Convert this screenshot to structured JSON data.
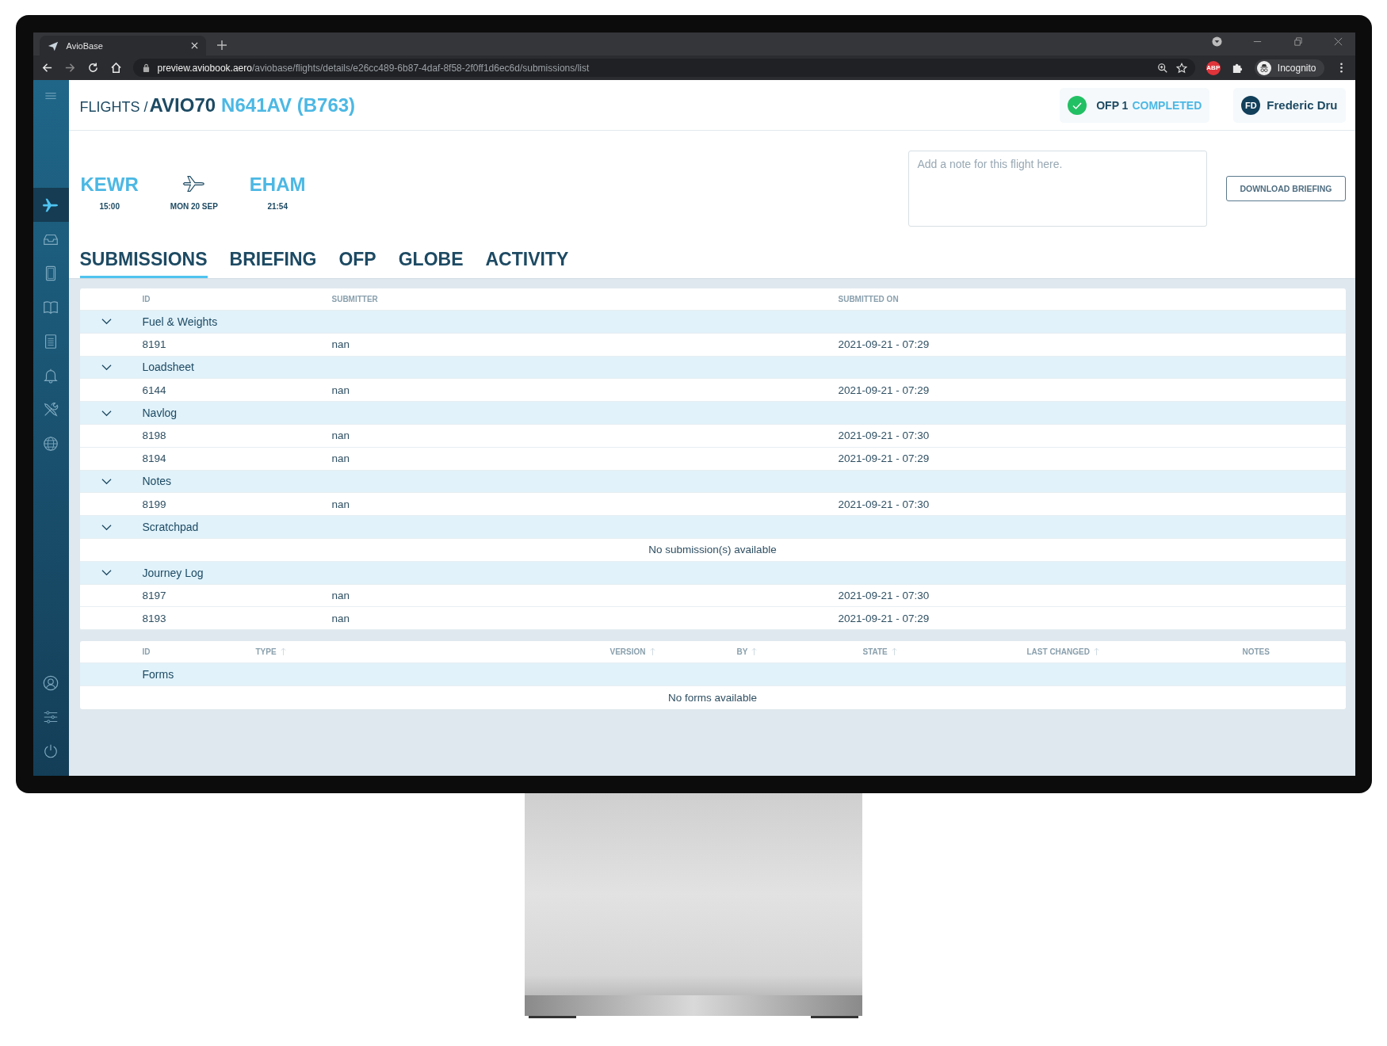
{
  "browser": {
    "tab_title": "AvioBase",
    "url_host": "preview.aviobook.aero",
    "url_path": "/aviobase/flights/details/e26cc489-6b87-4daf-8f58-2f0ff1d6ec6d/submissions/list",
    "adblock_badge": "ABP",
    "profile": "Incognito"
  },
  "sidebar": {
    "items": [
      {
        "kind": "plane",
        "selected": true
      },
      {
        "kind": "inbox",
        "selected": false
      },
      {
        "kind": "tablet",
        "selected": false
      },
      {
        "kind": "book",
        "selected": false
      },
      {
        "kind": "list",
        "selected": false
      },
      {
        "kind": "bell",
        "selected": false
      },
      {
        "kind": "tools",
        "selected": false
      },
      {
        "kind": "globe",
        "selected": false
      }
    ],
    "bottom_items": [
      {
        "kind": "user"
      },
      {
        "kind": "sliders"
      },
      {
        "kind": "power"
      }
    ]
  },
  "header": {
    "breadcrumb": "FLIGHTS /",
    "flight": "AVIO70",
    "registration": "N641AV (B763)",
    "status": {
      "label": "OFP 1",
      "state": "COMPLETED",
      "done": true
    },
    "user": {
      "initials": "FD",
      "name": "Frederic Dru"
    }
  },
  "route": {
    "origin": {
      "code": "KEWR",
      "time": "15:00"
    },
    "date": "MON 20 SEP",
    "destination": {
      "code": "EHAM",
      "time": "21:54"
    }
  },
  "note": {
    "placeholder": "Add a note for this flight here."
  },
  "download_button": "DOWNLOAD BRIEFING",
  "tabs": [
    {
      "label": "SUBMISSIONS",
      "selected": true
    },
    {
      "label": "BRIEFING",
      "selected": false
    },
    {
      "label": "OFP",
      "selected": false
    },
    {
      "label": "GLOBE",
      "selected": false
    },
    {
      "label": "ACTIVITY",
      "selected": false
    }
  ],
  "submissions": {
    "columns": [
      "ID",
      "SUBMITTER",
      "SUBMITTED ON"
    ],
    "groups": [
      {
        "name": "Fuel & Weights",
        "expanded": true,
        "rows": [
          {
            "id": "8191",
            "submitter": "nan",
            "submitted_on": "2021-09-21 - 07:29"
          }
        ]
      },
      {
        "name": "Loadsheet",
        "expanded": true,
        "rows": [
          {
            "id": "6144",
            "submitter": "nan",
            "submitted_on": "2021-09-21 - 07:29"
          }
        ]
      },
      {
        "name": "Navlog",
        "expanded": true,
        "rows": [
          {
            "id": "8198",
            "submitter": "nan",
            "submitted_on": "2021-09-21 - 07:30"
          },
          {
            "id": "8194",
            "submitter": "nan",
            "submitted_on": "2021-09-21 - 07:29"
          }
        ]
      },
      {
        "name": "Notes",
        "expanded": true,
        "rows": [
          {
            "id": "8199",
            "submitter": "nan",
            "submitted_on": "2021-09-21 - 07:30"
          }
        ]
      },
      {
        "name": "Scratchpad",
        "expanded": true,
        "empty_text": "No submission(s) available"
      },
      {
        "name": "Journey Log",
        "expanded": true,
        "rows": [
          {
            "id": "8197",
            "submitter": "nan",
            "submitted_on": "2021-09-21 - 07:30"
          },
          {
            "id": "8193",
            "submitter": "nan",
            "submitted_on": "2021-09-21 - 07:29"
          }
        ]
      }
    ]
  },
  "forms": {
    "columns": [
      {
        "label": "ID",
        "sortable": false
      },
      {
        "label": "TYPE",
        "sortable": true
      },
      {
        "label": "VERSION",
        "sortable": true
      },
      {
        "label": "BY",
        "sortable": true
      },
      {
        "label": "STATE",
        "sortable": true
      },
      {
        "label": "LAST CHANGED",
        "sortable": true
      },
      {
        "label": "NOTES",
        "sortable": false
      }
    ],
    "group": "Forms",
    "empty_text": "No forms available"
  }
}
